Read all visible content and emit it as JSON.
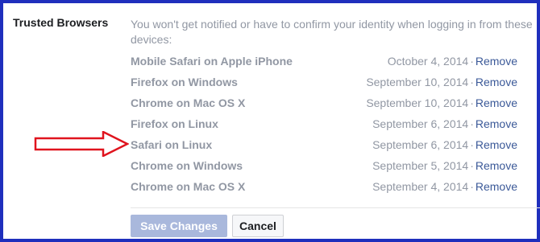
{
  "section": {
    "title": "Trusted Browsers",
    "description": "You won't get notified or have to confirm your identity when logging in from these devices:"
  },
  "devices": [
    {
      "name": "Mobile Safari on Apple iPhone",
      "date": "October 4, 2014",
      "action": "Remove"
    },
    {
      "name": "Firefox on Windows",
      "date": "September 10, 2014",
      "action": "Remove"
    },
    {
      "name": "Chrome on Mac OS X",
      "date": "September 10, 2014",
      "action": "Remove"
    },
    {
      "name": "Firefox on Linux",
      "date": "September 6, 2014",
      "action": "Remove"
    },
    {
      "name": "Safari on Linux",
      "date": "September 6, 2014",
      "action": "Remove"
    },
    {
      "name": "Chrome on Windows",
      "date": "September 5, 2014",
      "action": "Remove"
    },
    {
      "name": "Chrome on Mac OS X",
      "date": "September 4, 2014",
      "action": "Remove"
    }
  ],
  "separator": "·",
  "buttons": {
    "save": "Save Changes",
    "cancel": "Cancel"
  },
  "colors": {
    "frame_border": "#1f2fbd",
    "arrow": "#e0141e",
    "link": "#3b5998",
    "muted_text": "#9197a3",
    "save_button_disabled": "#a9b8dc"
  },
  "annotation": {
    "icon": "red-outline-arrow-icon"
  }
}
